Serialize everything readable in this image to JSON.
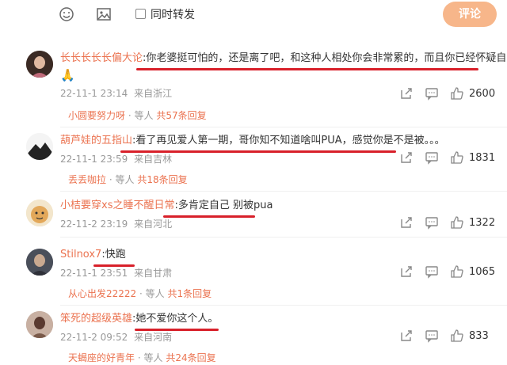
{
  "toolbar": {
    "repost_label": "同时转发",
    "submit_label": "评论"
  },
  "comments": [
    {
      "username": "长长长长长偏大论",
      "text": ":你老婆挺可怕的，还是离了吧，和这种人相处你会非常累的，而且你已经怀疑自己了",
      "emoji": "🙏",
      "time": "22-11-1 23:14",
      "location": "来自浙江",
      "likes": "2600",
      "reply_user": "小圆要努力呀",
      "reply_mid": "· 等人",
      "reply_count": "共57条回复"
    },
    {
      "username": "葫芦娃的五指山",
      "text": ":看了再见爱人第一期，哥你知不知道啥叫PUA，感觉你是不是被。。。",
      "time": "22-11-1 23:59",
      "location": "来自吉林",
      "likes": "1831",
      "reply_user": "丢丢咖拉",
      "reply_mid": "· 等人",
      "reply_count": "共18条回复"
    },
    {
      "username": "小桔要穿xs之睡不醒日常",
      "text": ":多肯定自己 别被pua",
      "time": "22-11-2 23:19",
      "location": "来自河北",
      "likes": "1322"
    },
    {
      "username": "Stilnox7",
      "text": ":快跑",
      "time": "22-11-1 23:51",
      "location": "来自甘肃",
      "likes": "1065",
      "reply_user": "从心出发22222",
      "reply_mid": "· 等人",
      "reply_count": "共1条回复"
    },
    {
      "username": "笨死的超级英雄",
      "text": ":她不爱你这个人。",
      "time": "22-11-2 09:52",
      "location": "来自河南",
      "likes": "833",
      "reply_user": "天蝎座的好青年",
      "reply_mid": "· 等人",
      "reply_count": "共24条回复"
    }
  ],
  "colors": {
    "accent": "#eb7350",
    "submit": "#f7b68a",
    "underline": "#d8202a"
  }
}
